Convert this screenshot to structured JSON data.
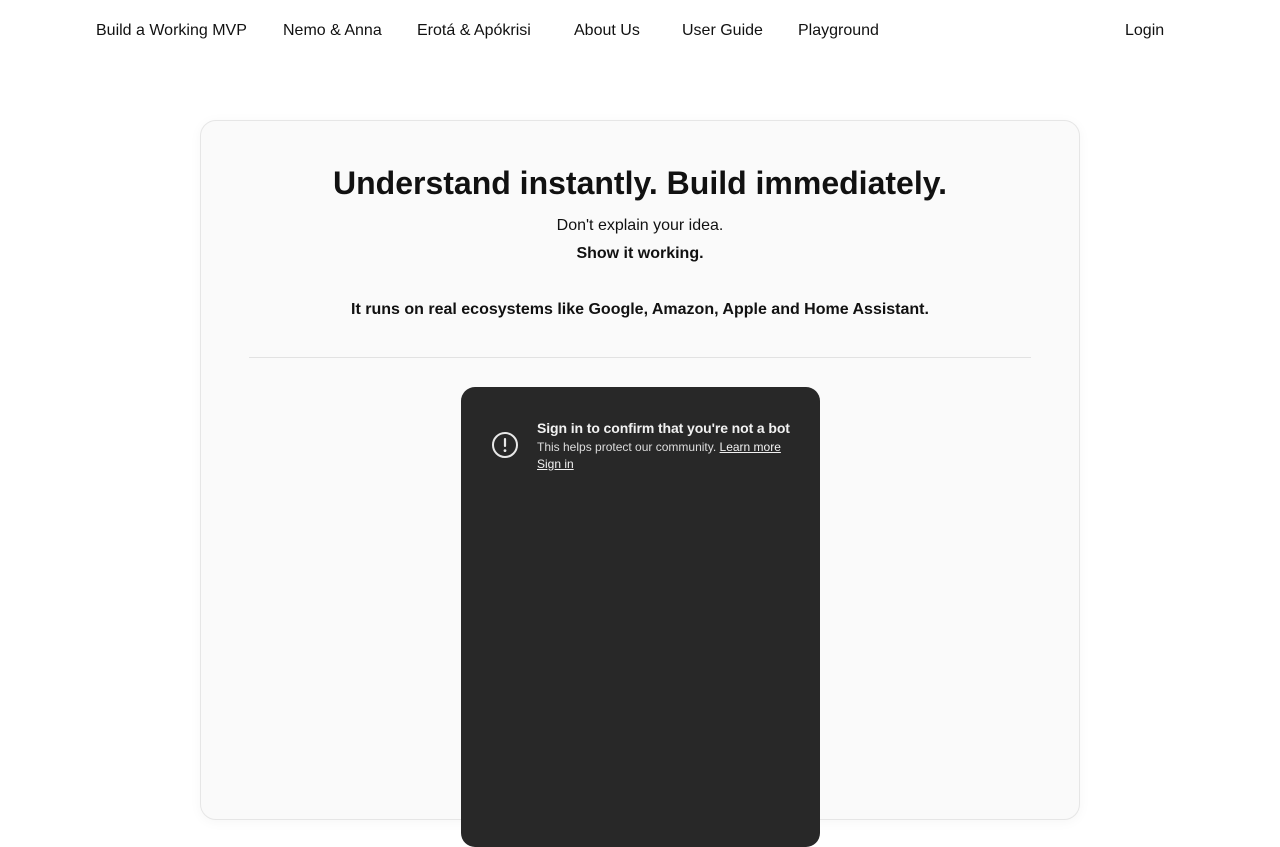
{
  "nav": {
    "items": [
      {
        "label": "Build a Working MVP"
      },
      {
        "label": "Nemo & Anna"
      },
      {
        "label": "Erotá & Apókrisi"
      },
      {
        "label": "About Us"
      },
      {
        "label": "User Guide"
      },
      {
        "label": "Playground"
      }
    ],
    "login": "Login"
  },
  "hero": {
    "headline": "Understand instantly. Build immediately.",
    "line1": "Don't explain your idea.",
    "line2": "Show it working.",
    "line3": "It runs on real ecosystems like Google, Amazon, Apple and Home Assistant."
  },
  "video": {
    "title": "Sign in to confirm that you're not a bot",
    "body": "This helps protect our community.",
    "learn_more": "Learn more",
    "sign_in": "Sign in",
    "icon": "alert-circle-icon",
    "background": "#282828"
  }
}
